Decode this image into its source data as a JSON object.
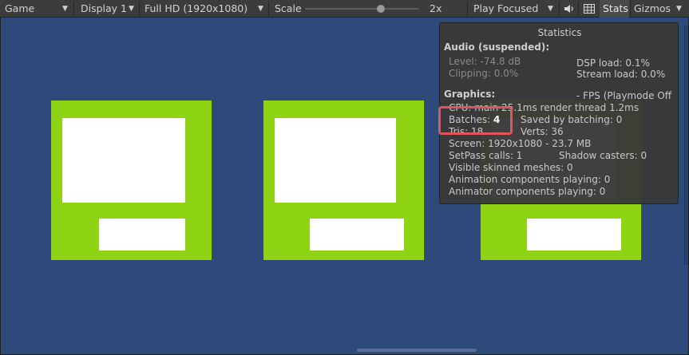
{
  "toolbar": {
    "view_label": "Game",
    "display_label": "Display 1",
    "resolution_label": "Full HD (1920x1080)",
    "scale_label": "Scale",
    "scale_value": "2x",
    "play_mode_label": "Play Focused",
    "stats_label": "Stats",
    "gizmos_label": "Gizmos"
  },
  "stats": {
    "title": "Statistics",
    "audio_heading": "Audio (suspended):",
    "level": "Level: -74.8 dB",
    "clipping": "Clipping: 0.0%",
    "dsp_load": "DSP load: 0.1%",
    "stream_load": "Stream load: 0.0%",
    "graphics_heading": "Graphics:",
    "fps": "- FPS (Playmode Off",
    "cpu": "CPU: main 25.1ms  render thread 1.2ms",
    "batches_label": "Batches:",
    "batches_value": "4",
    "saved_by_batching": "Saved by batching: 0",
    "tris": "Tris: 18",
    "verts": "Verts: 36",
    "screen": "Screen: 1920x1080 - 23.7 MB",
    "setpass": "SetPass calls: 1",
    "shadow_casters": "Shadow casters: 0",
    "skinned_meshes": "Visible skinned meshes: 0",
    "animation_components": "Animation components playing: 0",
    "animator_components": "Animator components playing: 0"
  },
  "colors": {
    "background": "#2d4a7a",
    "card_green": "#8fd414",
    "highlight": "#e0555d"
  }
}
